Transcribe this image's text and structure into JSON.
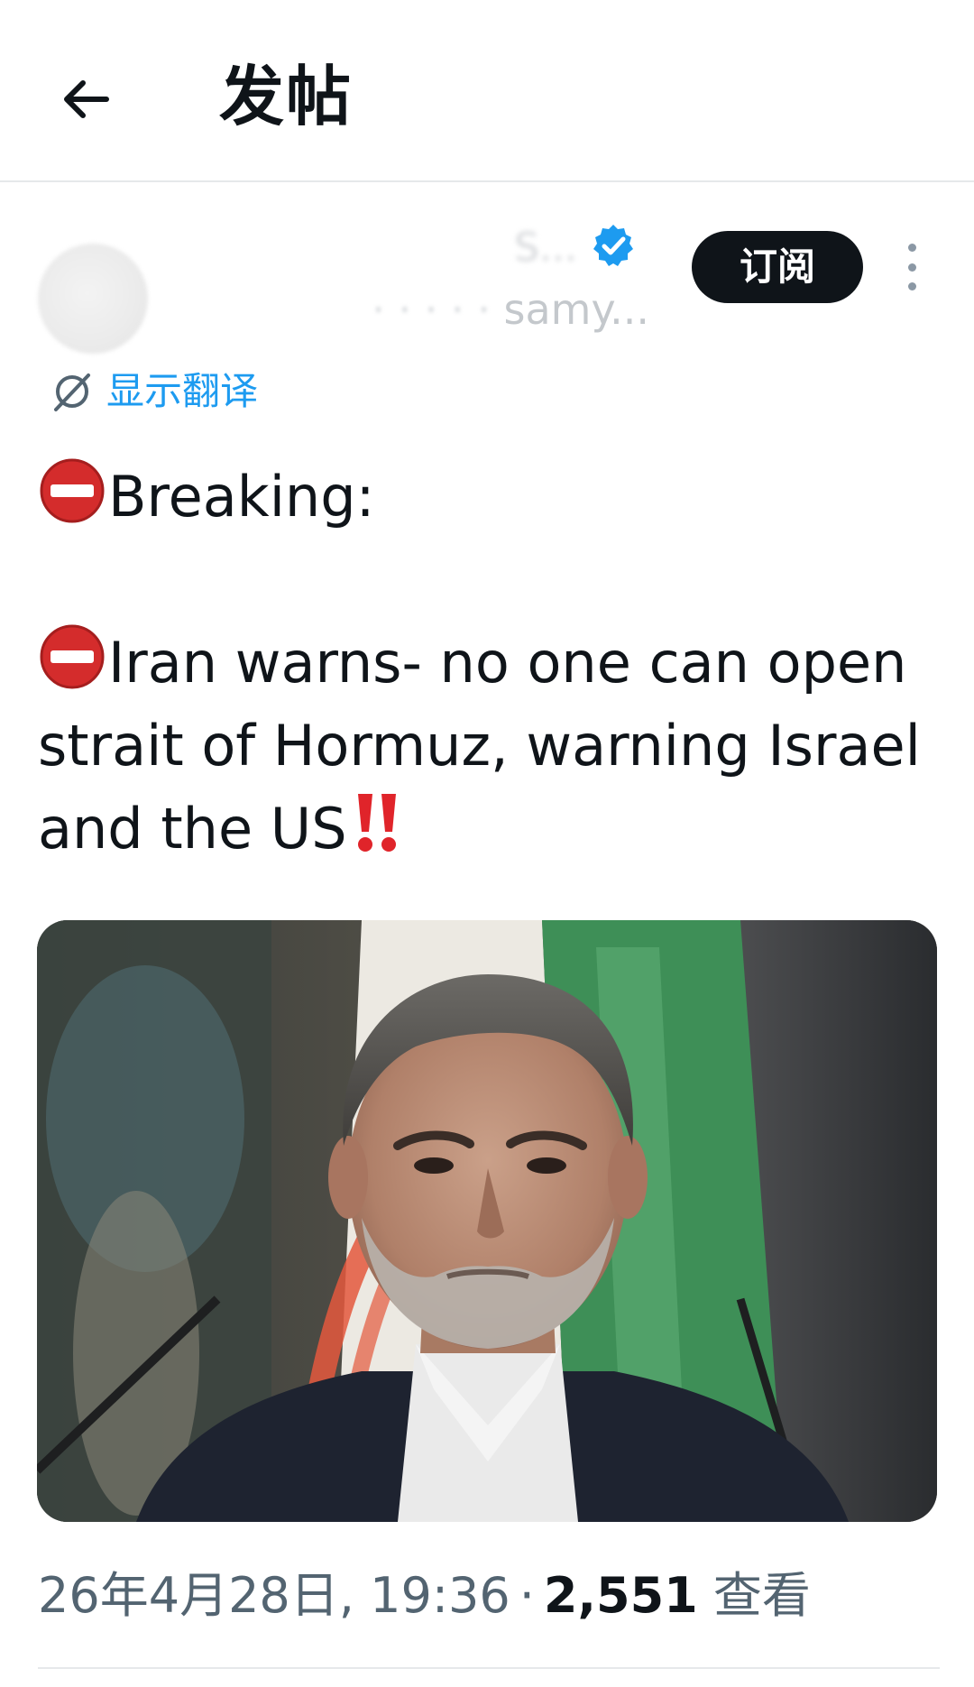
{
  "header": {
    "back_icon": "arrow-left-icon",
    "title": "发帖"
  },
  "author": {
    "display_name": "S...",
    "handle_visible": "samy...",
    "verified_icon": "verified-badge-icon",
    "verified_color": "#1d9bf0"
  },
  "actions": {
    "subscribe_label": "订阅",
    "more_icon": "vertical-ellipsis-icon"
  },
  "translate": {
    "icon": "translate-icon",
    "label": "显示翻译",
    "color": "#1d9bf0"
  },
  "tweet": {
    "line1": "Breaking:",
    "line2": "Iran warns-  no one can open strait of Hormuz, warning Israel and the US",
    "emoji_stop": "no-entry-emoji",
    "emoji_bang": "double-exclamation-emoji"
  },
  "media": {
    "type": "photo",
    "subject": "man-in-dark-suit-in-front-of-flag-photo"
  },
  "meta": {
    "timestamp": "26年4月28日, 19:36",
    "separator": "·",
    "views_count": "2,551",
    "views_label": "查看"
  }
}
